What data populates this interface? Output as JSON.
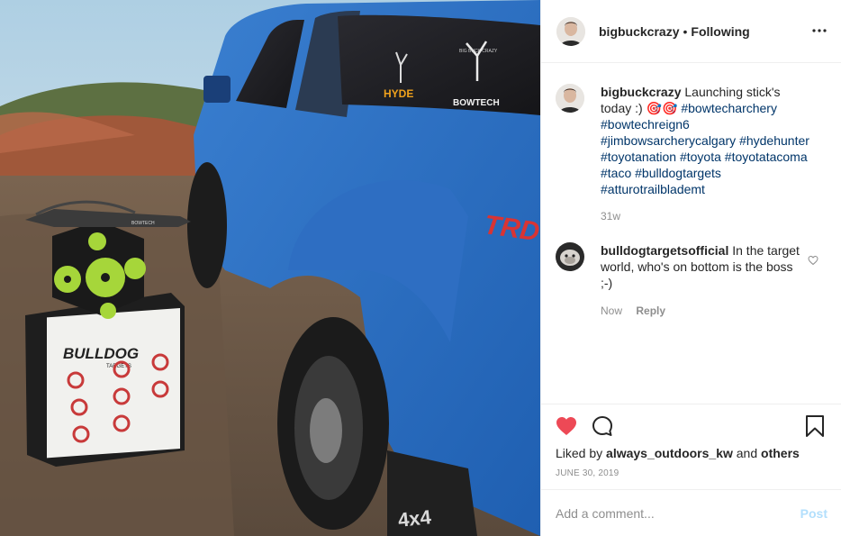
{
  "photo": {
    "truck_badge": "TRD",
    "truck_emblem": "4x4",
    "window_sticker_left": "HYDE",
    "window_sticker_right": "BOWTECH",
    "window_sticker_top": "BIG BUCK CRAZY",
    "crossbow_brand": "BOWTECH",
    "target_brand": "BULLDOG",
    "target_subtitle": "TARGETS"
  },
  "header": {
    "username": "bigbuckcrazy",
    "separator": "•",
    "follow_state": "Following",
    "more_icon": "ellipsis-icon"
  },
  "caption": {
    "username": "bigbuckcrazy",
    "text": "Launching stick's today :)",
    "emojis": "🎯🎯",
    "hashtags": [
      "#bowtecharchery",
      "#bowtechreign6",
      "#jimbowsarcherycalgary",
      "#hydehunter",
      "#toyotanation",
      "#toyota",
      "#toyotatacoma",
      "#taco",
      "#bulldogtargets",
      "#atturotrailblademt"
    ],
    "time": "31w"
  },
  "comment": {
    "username": "bulldogtargetsofficial",
    "text": "In the target world, who's on bottom is the boss ;-)",
    "time": "Now",
    "reply_label": "Reply"
  },
  "actions": {
    "like_icon": "heart-filled-icon",
    "comment_icon": "comment-icon",
    "save_icon": "bookmark-icon",
    "liked_by_prefix": "Liked by",
    "liked_by_user": "always_outdoors_kw",
    "liked_by_and": "and",
    "liked_by_others": "others",
    "date": "JUNE 30, 2019",
    "like_color": "#ed4956"
  },
  "add_comment": {
    "placeholder": "Add a comment...",
    "post_label": "Post"
  }
}
